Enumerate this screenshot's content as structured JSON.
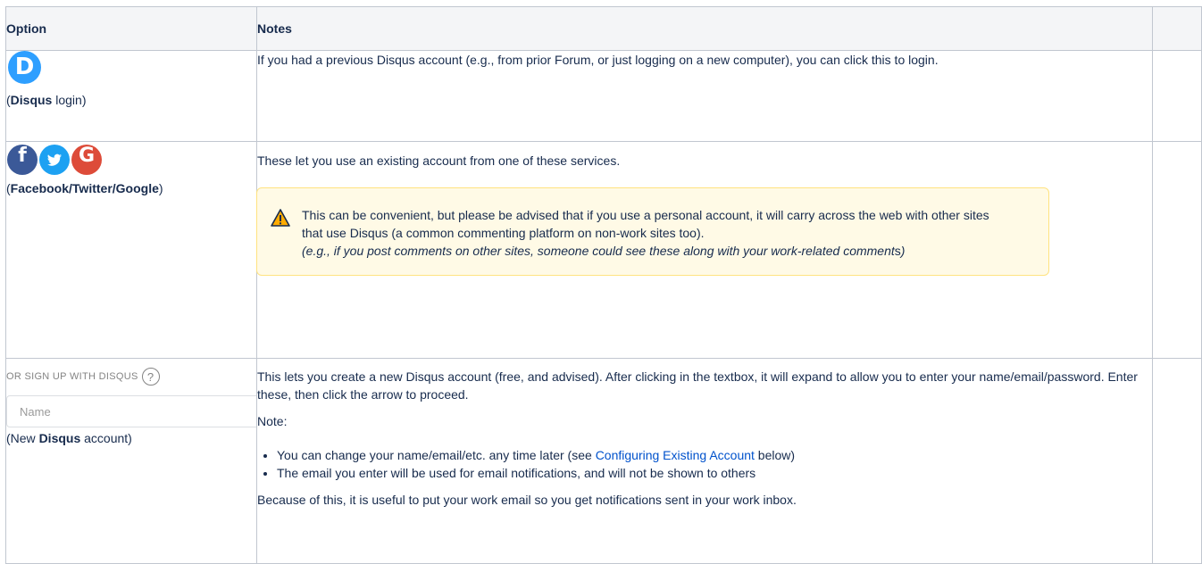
{
  "table": {
    "headers": {
      "option": "Option",
      "notes": "Notes",
      "extra": ""
    },
    "rows": [
      {
        "icon": "disqus-icon",
        "icon_glyph": "D",
        "caption_pre": "(",
        "caption_bold": "Disqus",
        "caption_post": " login)",
        "notes": "If you had a previous Disqus account (e.g., from prior Forum, or just logging on a new computer), you can click this to login."
      },
      {
        "icons": [
          {
            "name": "facebook-icon",
            "glyph": "f",
            "color": "#3b5998"
          },
          {
            "name": "twitter-icon",
            "glyph": "🐦",
            "color": "#1da1f2"
          },
          {
            "name": "google-icon",
            "glyph": "G",
            "color": "#dd4b39"
          }
        ],
        "caption_pre": "(",
        "caption_bold": "Facebook/Twitter/Google",
        "caption_post": ")",
        "notes": "These let you use an existing account from one of these services.",
        "warning": {
          "icon": "warning-icon",
          "text": "This can be convenient, but please be advised that if you use a personal account, it will carry across the web with other sites that use Disqus (a common commenting platform on non-work sites too).",
          "italic_main": "(e.g., if you post comments on other sites, someone could see these along with your work-related comment",
          "italic_tail_plain": "s",
          "italic_close": ")"
        }
      },
      {
        "signup_label": "OR SIGN UP WITH DISQUS",
        "help_glyph": "?",
        "name_placeholder": "Name",
        "caption_pre": "(New ",
        "caption_bold": "Disqus",
        "caption_post": " account)",
        "notes_intro": "This lets you create a new Disqus account (free, and advised).  After clicking in the textbox, it will expand to allow you to enter your name/email/password.  Enter these, then click the arrow to proceed.",
        "note_label": "Note:",
        "bullet1_pre": "You can change your name/email/etc. any time later (see ",
        "bullet1_link": "Configuring Existing Account",
        "bullet1_post": " below)",
        "bullet2": "The email you enter will be used for email notifications, and will not be shown to others",
        "closing": "Because of this, it is useful to put your work email so you get notifications sent in your work inbox."
      }
    ]
  },
  "colors": {
    "header_bg": "#f4f5f7",
    "border": "#c1c7d0",
    "warning_bg": "#fffae6",
    "warning_border": "#ffe380",
    "link": "#0052cc",
    "disqus_blue": "#2e9fff"
  }
}
